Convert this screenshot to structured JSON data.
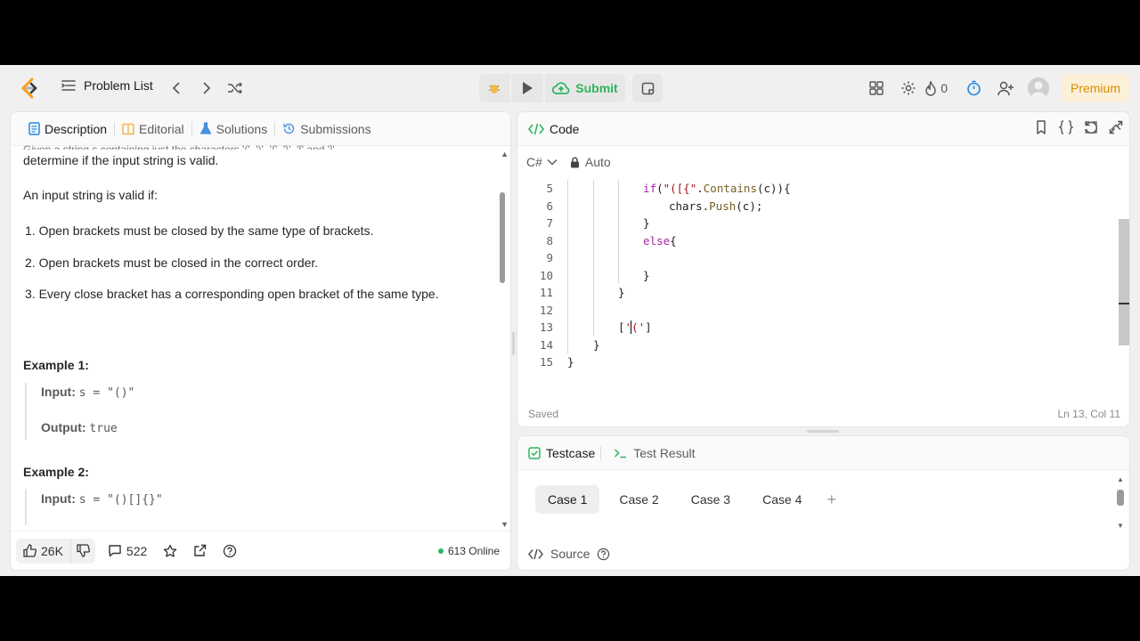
{
  "nav": {
    "problem_list": "Problem List",
    "submit": "Submit",
    "streak": "0",
    "premium": "Premium"
  },
  "left": {
    "tabs": [
      "Description",
      "Editorial",
      "Solutions",
      "Submissions"
    ],
    "cut_line": "Given a string s containing just the characters '(', ')', '{', '}', '[' and ']',",
    "line1": "determine if the input string is valid.",
    "line2": "An input string is valid if:",
    "rules": [
      "1. Open brackets must be closed by the same type of brackets.",
      "2. Open brackets must be closed in the correct order.",
      "3. Every close bracket has a corresponding open bracket of the same type."
    ],
    "example1_title": "Example 1:",
    "example1_input_label": "Input:",
    "example1_input": "s = \"()\"",
    "example1_output_label": "Output:",
    "example1_output": "true",
    "example2_title": "Example 2:",
    "example2_input_label": "Input:",
    "example2_input": "s = \"()[]{}\"",
    "likes": "26K",
    "comments": "522",
    "online": "613 Online"
  },
  "code": {
    "title": "Code",
    "lang": "C#",
    "auto": "Auto",
    "status": "Saved",
    "cursor": "Ln 13, Col 11"
  },
  "test": {
    "tab1": "Testcase",
    "tab2": "Test Result",
    "cases": [
      "Case 1",
      "Case 2",
      "Case 3",
      "Case 4"
    ],
    "source": "Source"
  },
  "colors": {
    "accent_green": "#2db55d",
    "premium": "#d98c00",
    "timer_blue": "#1e88e5"
  }
}
